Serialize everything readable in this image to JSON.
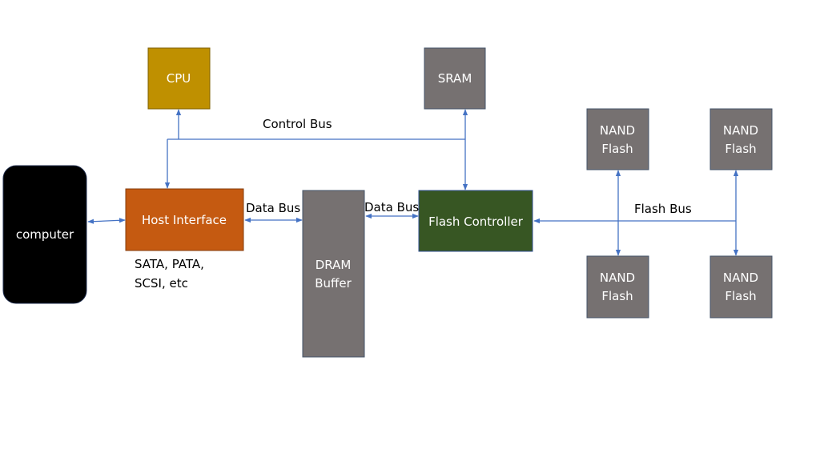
{
  "colors": {
    "cpu": "#BF9000",
    "gray": "#767171",
    "host_interface": "#C55A11",
    "flash_controller": "#375623",
    "computer": "#000000",
    "bus_line": "#4472C4"
  },
  "blocks": {
    "cpu": "CPU",
    "sram": "SRAM",
    "computer": "computer",
    "host_interface": "Host Interface",
    "dram": [
      "DRAM",
      "Buffer"
    ],
    "flash_controller": "Flash Controller",
    "nand": [
      [
        "NAND",
        "Flash"
      ],
      [
        "NAND",
        "Flash"
      ],
      [
        "NAND",
        "Flash"
      ],
      [
        "NAND",
        "Flash"
      ]
    ]
  },
  "labels": {
    "control_bus": "Control Bus",
    "data_bus_1": "Data Bus",
    "data_bus_2": "Data Bus",
    "flash_bus": "Flash Bus",
    "interfaces_line1": "SATA, PATA,",
    "interfaces_line2": "SCSI, etc"
  }
}
